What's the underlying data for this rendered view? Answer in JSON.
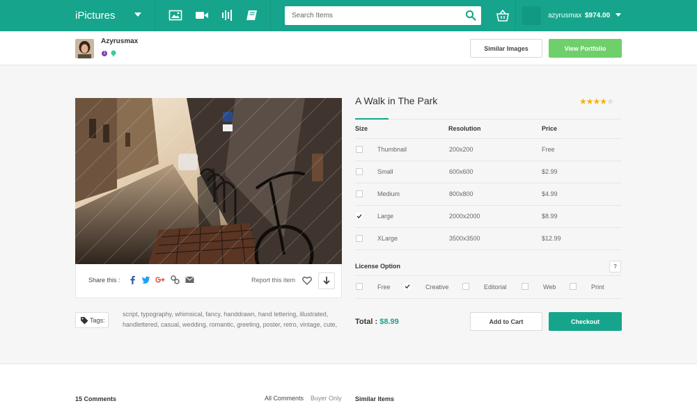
{
  "header": {
    "brand": "iPictures",
    "search_placeholder": "Search Items",
    "username": "azyrusmax",
    "balance": "$974.00"
  },
  "author": {
    "name": "Azyrusmax",
    "badge": "1"
  },
  "actions": {
    "similar_images": "Similar Images",
    "view_portfolio": "View Portfolio"
  },
  "item": {
    "title": "A Walk in The Park",
    "rating": 4,
    "rating_max": 5
  },
  "share": {
    "label": "Share this :",
    "report": "Report this item"
  },
  "tags": {
    "label": "Tags:",
    "line1": "script, typography, whimsical, fancy, handdrawn, hand lettering, illustrated,",
    "line2": "handlettered, casual, wedding, romantic, greeting, poster, retro, vintage, cute,"
  },
  "table": {
    "headers": [
      "Size",
      "Resolution",
      "Price"
    ],
    "rows": [
      {
        "size": "Thumbnail",
        "resolution": "200x200",
        "price": "Free",
        "checked": false
      },
      {
        "size": "Small",
        "resolution": "600x600",
        "price": "$2.99",
        "checked": false
      },
      {
        "size": "Medium",
        "resolution": "800x800",
        "price": "$4.99",
        "checked": false
      },
      {
        "size": "Large",
        "resolution": "2000x2000",
        "price": "$8.99",
        "checked": true
      },
      {
        "size": "XLarge",
        "resolution": "3500x3500",
        "price": "$12.99",
        "checked": false
      }
    ]
  },
  "license": {
    "title": "License Option",
    "help": "?",
    "options": [
      {
        "label": "Free",
        "checked": false
      },
      {
        "label": "Creative",
        "checked": true
      },
      {
        "label": "Editorial",
        "checked": false
      },
      {
        "label": "Web",
        "checked": false
      },
      {
        "label": "Print",
        "checked": false
      }
    ]
  },
  "checkout": {
    "total_label": "Total :",
    "total_value": "$8.99",
    "add_to_cart": "Add to Cart",
    "checkout": "Checkout"
  },
  "bottom": {
    "comments": "15 Comments",
    "all_comments": "All Comments",
    "buyer_only": "Buyer Only",
    "similar_items": "Similar Items"
  },
  "colors": {
    "primary": "#16a58c",
    "green_button": "#6fcf6a",
    "star": "#f5b301"
  },
  "icons": [
    "chevron-down-icon",
    "image-icon",
    "video-icon",
    "audio-icon",
    "book-icon",
    "search-icon",
    "basket-icon",
    "facebook-icon",
    "twitter-icon",
    "google-plus-icon",
    "link-icon",
    "email-icon",
    "heart-icon",
    "download-icon",
    "tag-icon",
    "check-icon"
  ]
}
